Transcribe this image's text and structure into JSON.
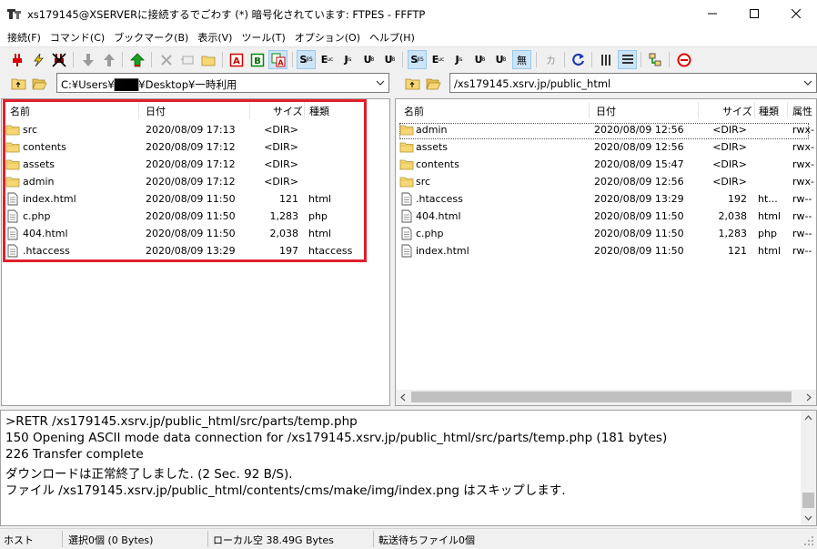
{
  "window": {
    "title": "xs179145@XSERVERに接続するでごわす (*) 暗号化されています: FTPES - FFFTP"
  },
  "menu": [
    {
      "label": "接続(F)"
    },
    {
      "label": "コマンド(C)"
    },
    {
      "label": "ブックマーク(B)"
    },
    {
      "label": "表示(V)"
    },
    {
      "label": "ツール(T)"
    },
    {
      "label": "オプション(O)"
    },
    {
      "label": "ヘルプ(H)"
    }
  ],
  "toolbar": {
    "sjis": "S",
    "euc": "E",
    "jis": "J",
    "utf8": "U",
    "utf8n": "U",
    "nocode": "無",
    "kana": "カ"
  },
  "local": {
    "path": "C:¥Users¥███¥Desktop¥一時利用",
    "columns": {
      "name": "名前",
      "date": "日付",
      "size": "サイズ",
      "type": "種類"
    },
    "files": [
      {
        "name": "src",
        "date": "2020/08/09 17:13",
        "size": "<DIR>",
        "type": "",
        "icon": "folder-icon"
      },
      {
        "name": "contents",
        "date": "2020/08/09 17:12",
        "size": "<DIR>",
        "type": "",
        "icon": "folder-icon"
      },
      {
        "name": "assets",
        "date": "2020/08/09 17:12",
        "size": "<DIR>",
        "type": "",
        "icon": "folder-icon"
      },
      {
        "name": "admin",
        "date": "2020/08/09 17:12",
        "size": "<DIR>",
        "type": "",
        "icon": "folder-icon"
      },
      {
        "name": "index.html",
        "date": "2020/08/09 11:50",
        "size": "121",
        "type": "html",
        "icon": "file-icon"
      },
      {
        "name": "c.php",
        "date": "2020/08/09 11:50",
        "size": "1,283",
        "type": "php",
        "icon": "file-icon"
      },
      {
        "name": "404.html",
        "date": "2020/08/09 11:50",
        "size": "2,038",
        "type": "html",
        "icon": "file-icon"
      },
      {
        "name": ".htaccess",
        "date": "2020/08/09 13:29",
        "size": "197",
        "type": "htaccess",
        "icon": "file-icon"
      }
    ]
  },
  "remote": {
    "path": "/xs179145.xsrv.jp/public_html",
    "columns": {
      "name": "名前",
      "date": "日付",
      "size": "サイズ",
      "type": "種類",
      "attr": "属性"
    },
    "files": [
      {
        "name": "admin",
        "date": "2020/08/09 12:56",
        "size": "<DIR>",
        "type": "",
        "attr": "rwx-",
        "icon": "folder-icon"
      },
      {
        "name": "assets",
        "date": "2020/08/09 12:56",
        "size": "<DIR>",
        "type": "",
        "attr": "rwx-",
        "icon": "folder-icon"
      },
      {
        "name": "contents",
        "date": "2020/08/09 15:47",
        "size": "<DIR>",
        "type": "",
        "attr": "rwx-",
        "icon": "folder-icon"
      },
      {
        "name": "src",
        "date": "2020/08/09 12:56",
        "size": "<DIR>",
        "type": "",
        "attr": "rwx-",
        "icon": "folder-icon"
      },
      {
        "name": ".htaccess",
        "date": "2020/08/09 13:29",
        "size": "192",
        "type": "ht...",
        "attr": "rw--",
        "icon": "file-icon"
      },
      {
        "name": "404.html",
        "date": "2020/08/09 11:50",
        "size": "2,038",
        "type": "html",
        "attr": "rw--",
        "icon": "file-icon"
      },
      {
        "name": "c.php",
        "date": "2020/08/09 11:50",
        "size": "1,283",
        "type": "php",
        "attr": "rw--",
        "icon": "file-icon"
      },
      {
        "name": "index.html",
        "date": "2020/08/09 11:50",
        "size": "121",
        "type": "html",
        "attr": "rw--",
        "icon": "file-icon"
      }
    ]
  },
  "log": [
    ">RETR /xs179145.xsrv.jp/public_html/src/parts/temp.php",
    "150 Opening ASCII mode data connection for /xs179145.xsrv.jp/public_html/src/parts/temp.php (181 bytes)",
    "226 Transfer complete",
    "ダウンロードは正常終了しました. (2 Sec. 92 B/S).",
    "ファイル /xs179145.xsrv.jp/public_html/contents/cms/make/img/index.png はスキップします."
  ],
  "status": {
    "host": "ホスト",
    "selection": "選択0個 (0 Bytes)",
    "local_free": "ローカル空 38.49G Bytes",
    "queue": "転送待ちファイル0個"
  },
  "colors": {
    "highlight": "#e0202c",
    "accent": "#cce4f7"
  }
}
